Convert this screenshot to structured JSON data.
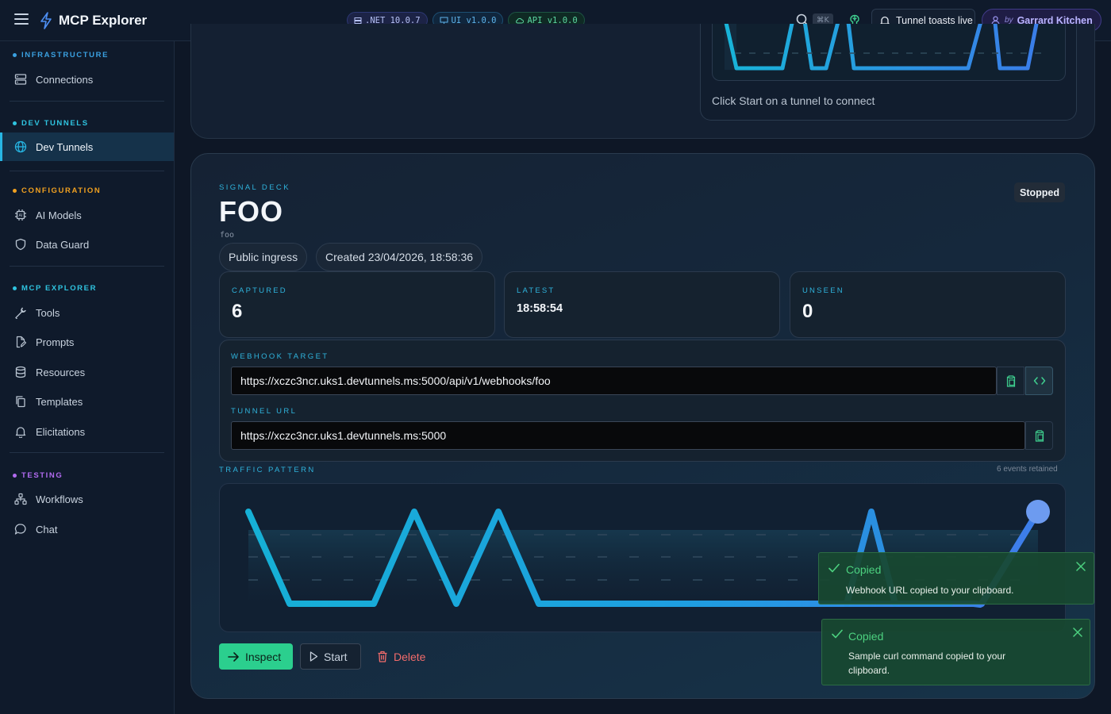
{
  "app": {
    "title": "MCP Explorer"
  },
  "badges": {
    "net": ".NET 10.0.7",
    "ui": "UI v1.0.0",
    "api": "API v1.0.0"
  },
  "header": {
    "shortcut": "⌘K",
    "toasts_label": "Tunnel toasts live",
    "user_by": "by",
    "user_name": "Garrard Kitchen"
  },
  "sidebar": {
    "sections": [
      {
        "title": "INFRASTRUCTURE",
        "color": "#3aa0e0",
        "items": [
          {
            "label": "Connections",
            "icon": "server-icon"
          }
        ]
      },
      {
        "title": "DEV TUNNELS",
        "color": "#2fc4e0",
        "items": [
          {
            "label": "Dev Tunnels",
            "icon": "globe-icon",
            "active": true
          }
        ]
      },
      {
        "title": "CONFIGURATION",
        "color": "#f0a020",
        "items": [
          {
            "label": "AI Models",
            "icon": "chip-icon"
          },
          {
            "label": "Data Guard",
            "icon": "shield-icon"
          }
        ]
      },
      {
        "title": "MCP EXPLORER",
        "color": "#2fc4e0",
        "items": [
          {
            "label": "Tools",
            "icon": "wrench-icon"
          },
          {
            "label": "Prompts",
            "icon": "file-edit-icon"
          },
          {
            "label": "Resources",
            "icon": "database-icon"
          },
          {
            "label": "Templates",
            "icon": "copy-icon"
          },
          {
            "label": "Elicitations",
            "icon": "bell-icon"
          }
        ]
      },
      {
        "title": "TESTING",
        "color": "#b26bf0",
        "items": [
          {
            "label": "Workflows",
            "icon": "workflow-icon"
          },
          {
            "label": "Chat",
            "icon": "chat-icon"
          }
        ]
      }
    ]
  },
  "top_card": {
    "hint": "Click Start on a tunnel to connect"
  },
  "deck": {
    "eyebrow": "SIGNAL DECK",
    "title": "FOO",
    "subtitle": "foo",
    "status": "Stopped",
    "pills": [
      "Public ingress",
      "Created 23/04/2026, 18:58:36"
    ],
    "stats": [
      {
        "label": "CAPTURED",
        "value": "6"
      },
      {
        "label": "LATEST",
        "value": "18:58:54"
      },
      {
        "label": "UNSEEN",
        "value": "0"
      }
    ],
    "webhook": {
      "label": "WEBHOOK TARGET",
      "value": "https://xczc3ncr.uks1.devtunnels.ms:5000/api/v1/webhooks/foo"
    },
    "tunnel": {
      "label": "TUNNEL URL",
      "value": "https://xczc3ncr.uks1.devtunnels.ms:5000"
    },
    "traffic": {
      "label": "TRAFFIC PATTERN",
      "meta": "6 events retained"
    },
    "actions": {
      "inspect": "Inspect",
      "start": "Start",
      "delete": "Delete"
    }
  },
  "toasts": [
    {
      "title": "Copied",
      "message": "Webhook URL copied to your clipboard."
    },
    {
      "title": "Copied",
      "message": "Sample curl command copied to your clipboard."
    }
  ],
  "colors": {
    "accent": "#2fb3dc",
    "primary": "#2bcf8e",
    "danger": "#f26b6b",
    "toast": "#4cd17f"
  }
}
